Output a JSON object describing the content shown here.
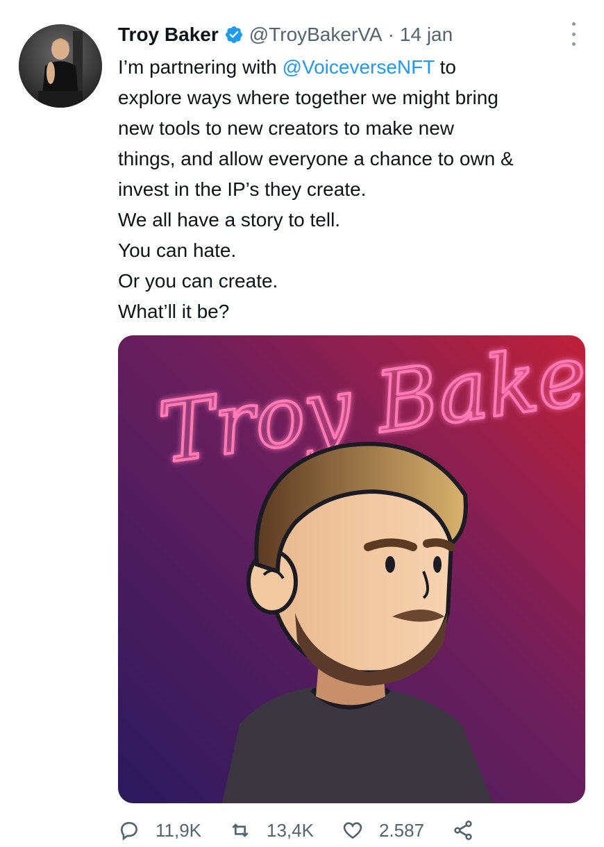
{
  "tweet": {
    "author_name": "Troy Baker",
    "handle": "@TroyBakerVA",
    "separator": "·",
    "date": "14 jan",
    "text_lines": [
      {
        "before": "I’m partnering with ",
        "mention": "@VoiceverseNFT",
        "after": " to"
      },
      "explore ways where together we might bring",
      "new tools to new creators to make new",
      "things, and allow everyone a chance to own &",
      "invest in the IP’s they create.",
      "We all have a story to tell.",
      "You can hate.",
      "Or you can create.",
      "What’ll it be?"
    ],
    "media": {
      "neon_text": "Troy Baker",
      "colors": {
        "bg_start": "#2a1a5e",
        "bg_mid": "#6b1f5c",
        "bg_end": "#c0203a",
        "neon": "#ff5fa2"
      }
    },
    "actions": {
      "replies": "11,9K",
      "retweets": "13,4K",
      "likes": "2.587"
    }
  },
  "colors": {
    "link": "#1d9bf0",
    "verified": "#1d9bf0",
    "secondary_text": "#536471"
  }
}
